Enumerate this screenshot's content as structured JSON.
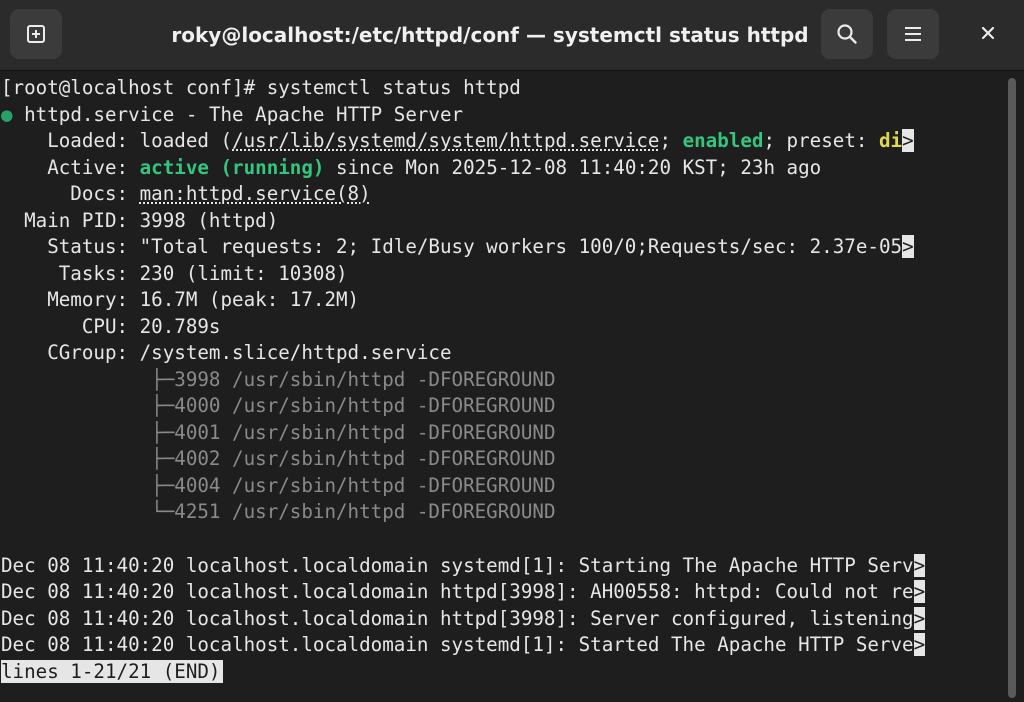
{
  "window": {
    "title": "roky@localhost:/etc/httpd/conf — systemctl status httpd",
    "new_tab_icon": "new-tab-icon",
    "search_icon": "search-icon",
    "menu_icon": "hamburger-menu-icon",
    "close_icon": "close-icon"
  },
  "colors": {
    "background": "#1e1e1e",
    "titlebar": "#2b2b2b",
    "text": "#e6e6e6",
    "active_green": "#33c67c",
    "bullet_green": "#26a269",
    "enabled_yellow": "#e2d84b",
    "tree_grey": "#8a8a8a"
  },
  "terminal": {
    "prompt": "[root@localhost conf]# systemctl status httpd",
    "service": {
      "bullet": "●",
      "text": " httpd.service - The Apache HTTP Server"
    },
    "loaded": {
      "label": "    Loaded: ",
      "pre": "loaded (",
      "path": "/usr/lib/systemd/system/httpd.service",
      "sep": "; ",
      "enabled": "enabled",
      "preset_text": "; preset: ",
      "preset_val": "di",
      "overflow": ">"
    },
    "active": {
      "label": "    Active: ",
      "state": "active (running)",
      "rest": " since Mon 2025-12-08 11:40:20 KST; 23h ago"
    },
    "docs": {
      "label": "      Docs: ",
      "value": "man:httpd.service(8)"
    },
    "main_pid": {
      "label": "  Main PID: ",
      "value": "3998 (httpd)"
    },
    "status": {
      "label": "    Status: ",
      "value": "\"Total requests: 2; Idle/Busy workers 100/0;Requests/sec: 2.37e-05",
      "overflow": ">"
    },
    "tasks": {
      "label": "     Tasks: ",
      "value": "230 (limit: 10308)"
    },
    "memory": {
      "label": "    Memory: ",
      "value": "16.7M (peak: 17.2M)"
    },
    "cpu": {
      "label": "       CPU: ",
      "value": "20.789s"
    },
    "cgroup": {
      "label": "    CGroup: ",
      "value": "/system.slice/httpd.service"
    },
    "processes": [
      {
        "branch": "             ├─",
        "text": "3998 /usr/sbin/httpd -DFOREGROUND"
      },
      {
        "branch": "             ├─",
        "text": "4000 /usr/sbin/httpd -DFOREGROUND"
      },
      {
        "branch": "             ├─",
        "text": "4001 /usr/sbin/httpd -DFOREGROUND"
      },
      {
        "branch": "             ├─",
        "text": "4002 /usr/sbin/httpd -DFOREGROUND"
      },
      {
        "branch": "             ├─",
        "text": "4004 /usr/sbin/httpd -DFOREGROUND"
      },
      {
        "branch": "             └─",
        "text": "4251 /usr/sbin/httpd -DFOREGROUND"
      }
    ],
    "logs": [
      {
        "text": "Dec 08 11:40:20 localhost.localdomain systemd[1]: Starting The Apache HTTP Serv",
        "overflow": ">"
      },
      {
        "text": "Dec 08 11:40:20 localhost.localdomain httpd[3998]: AH00558: httpd: Could not re",
        "overflow": ">"
      },
      {
        "text": "Dec 08 11:40:20 localhost.localdomain httpd[3998]: Server configured, listening",
        "overflow": ">"
      },
      {
        "text": "Dec 08 11:40:20 localhost.localdomain systemd[1]: Started The Apache HTTP Serve",
        "overflow": ">"
      }
    ],
    "pager_status": "lines 1-21/21 (END)"
  }
}
